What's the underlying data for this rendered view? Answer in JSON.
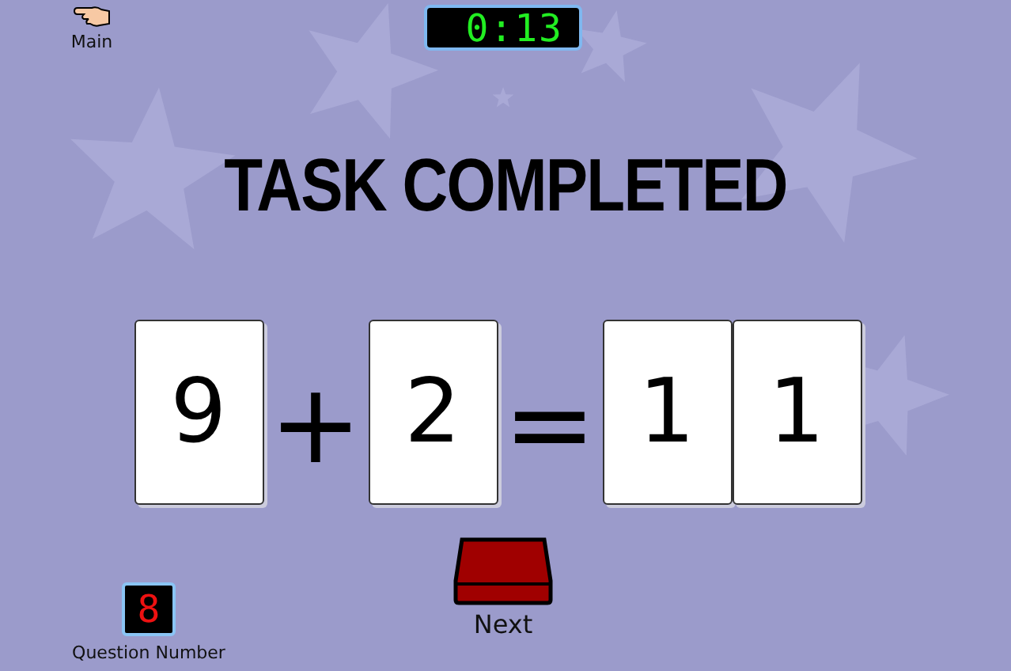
{
  "nav": {
    "label": "Main"
  },
  "timer": {
    "display": "0:13"
  },
  "title": "TASK COMPLETED",
  "equation": [
    {
      "kind": "card",
      "text": "9"
    },
    {
      "kind": "operator",
      "text": "+"
    },
    {
      "kind": "card",
      "text": "2"
    },
    {
      "kind": "operator",
      "text": "="
    },
    {
      "kind": "card",
      "text": "1"
    },
    {
      "kind": "card",
      "text": "1"
    }
  ],
  "question": {
    "number": "8",
    "label": "Question Number"
  },
  "next": {
    "label": "Next"
  }
}
